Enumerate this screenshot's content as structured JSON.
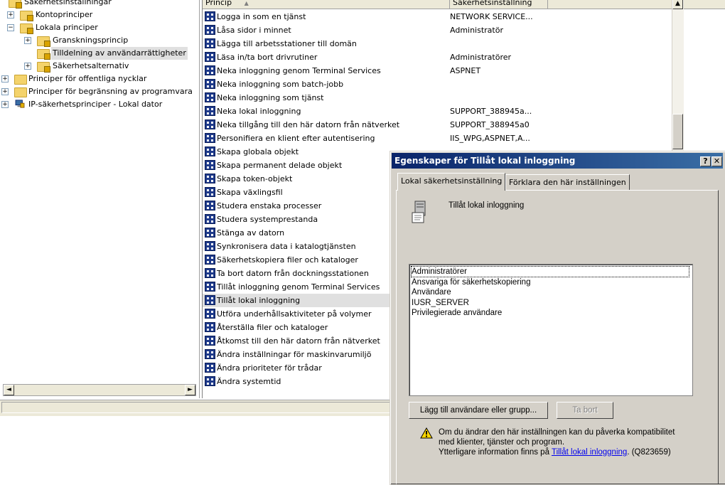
{
  "tree": {
    "items": [
      {
        "label": "Säkerhetsinställningar",
        "expander": ""
      },
      {
        "label": "Kontoprinciper",
        "expander": "+"
      },
      {
        "label": "Lokala principer",
        "expander": "−"
      },
      {
        "label": "Granskningsprincip",
        "expander": "+"
      },
      {
        "label": "Tilldelning av användarrättigheter",
        "expander": ""
      },
      {
        "label": "Säkerhetsalternativ",
        "expander": "+"
      },
      {
        "label": "Principer för offentliga nycklar",
        "expander": "+"
      },
      {
        "label": "Principer för begränsning av programvara",
        "expander": "+"
      },
      {
        "label": "IP-säkerhetsprinciper - Lokal dator",
        "expander": "+"
      }
    ],
    "scroll_left": "◄",
    "scroll_right": "►"
  },
  "list": {
    "columns": [
      "Princip",
      "Säkerhetsinställning"
    ],
    "sort_indicator": "▲",
    "scroll_up": "▲",
    "rows": [
      {
        "name": "Logga in som en tjänst",
        "value": "NETWORK SERVICE..."
      },
      {
        "name": "Låsa sidor i minnet",
        "value": "Administratör"
      },
      {
        "name": "Lägga till arbetsstationer till domän",
        "value": ""
      },
      {
        "name": "Läsa in/ta bort drivrutiner",
        "value": "Administratörer"
      },
      {
        "name": "Neka inloggning genom Terminal Services",
        "value": "ASPNET"
      },
      {
        "name": "Neka inloggning som batch-jobb",
        "value": ""
      },
      {
        "name": "Neka inloggning som tjänst",
        "value": ""
      },
      {
        "name": "Neka lokal inloggning",
        "value": "SUPPORT_388945a..."
      },
      {
        "name": "Neka tillgång till den här datorn från nätverket",
        "value": "SUPPORT_388945a0"
      },
      {
        "name": "Personifiera en klient efter autentisering",
        "value": "IIS_WPG,ASPNET,A..."
      },
      {
        "name": "Skapa globala objekt",
        "value": ""
      },
      {
        "name": "Skapa permanent delade objekt",
        "value": ""
      },
      {
        "name": "Skapa token-objekt",
        "value": ""
      },
      {
        "name": "Skapa växlingsfil",
        "value": ""
      },
      {
        "name": "Studera enstaka processer",
        "value": ""
      },
      {
        "name": "Studera systemprestanda",
        "value": ""
      },
      {
        "name": "Stänga av datorn",
        "value": ""
      },
      {
        "name": "Synkronisera data i katalogtjänsten",
        "value": ""
      },
      {
        "name": "Säkerhetskopiera filer och kataloger",
        "value": ""
      },
      {
        "name": "Ta bort datorn från dockningsstationen",
        "value": ""
      },
      {
        "name": "Tillåt inloggning genom Terminal Services",
        "value": ""
      },
      {
        "name": "Tillåt lokal inloggning",
        "value": ""
      },
      {
        "name": "Utföra underhållsaktiviteter på volymer",
        "value": ""
      },
      {
        "name": "Återställa filer och kataloger",
        "value": ""
      },
      {
        "name": "Åtkomst till den här datorn från nätverket",
        "value": ""
      },
      {
        "name": "Ändra inställningar för maskinvarumiljö",
        "value": ""
      },
      {
        "name": "Ändra prioriteter för trådar",
        "value": ""
      },
      {
        "name": "Ändra systemtid",
        "value": ""
      }
    ],
    "selected_row": "Tillåt lokal inloggning"
  },
  "dialog": {
    "title": "Egenskaper för Tillåt lokal inloggning",
    "help_button": "?",
    "close_button": "✕",
    "tabs": [
      "Lokal säkerhetsinställning",
      "Förklara den här inställningen"
    ],
    "policy_name": "Tillåt lokal inloggning",
    "members": [
      "Administratörer",
      "Ansvariga för säkerhetskopiering",
      "Användare",
      "IUSR_SERVER",
      "Privilegierade användare"
    ],
    "add_button": "Lägg till användare eller grupp...",
    "remove_button": "Ta bort",
    "warning_line1": "Om du ändrar den här inställningen kan du påverka kompatibilitet",
    "warning_line2": "med klienter, tjänster och program.",
    "warning_line3_prefix": "Ytterligare information finns på ",
    "warning_link": "Tillåt lokal inloggning",
    "warning_line3_suffix": ". (Q823659)"
  },
  "colors": {
    "title_bar_start": "#0a246a",
    "title_bar_end": "#3a6ea5",
    "selection": "#e0e0e0",
    "dialog_face": "#d4d0c8"
  }
}
